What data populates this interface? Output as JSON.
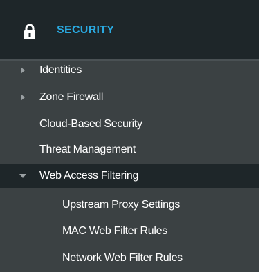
{
  "section": {
    "title": "SECURITY",
    "icon": "lock-icon"
  },
  "items": [
    {
      "label": "Identities",
      "expandable": true,
      "expanded": false
    },
    {
      "label": "Zone Firewall",
      "expandable": true,
      "expanded": false
    },
    {
      "label": "Cloud-Based Security",
      "expandable": false
    },
    {
      "label": "Threat Management",
      "expandable": false
    },
    {
      "label": "Web Access Filtering",
      "expandable": true,
      "expanded": true
    },
    {
      "label": "Upstream Proxy Settings",
      "expandable": false
    },
    {
      "label": "MAC Web Filter Rules",
      "expandable": false
    },
    {
      "label": "Network Web Filter Rules",
      "expandable": false
    }
  ],
  "colors": {
    "header_bg": "#1e2629",
    "menu_bg": "#3b4143",
    "accent": "#2aa9e0",
    "arrow": "#9aa0a3"
  }
}
